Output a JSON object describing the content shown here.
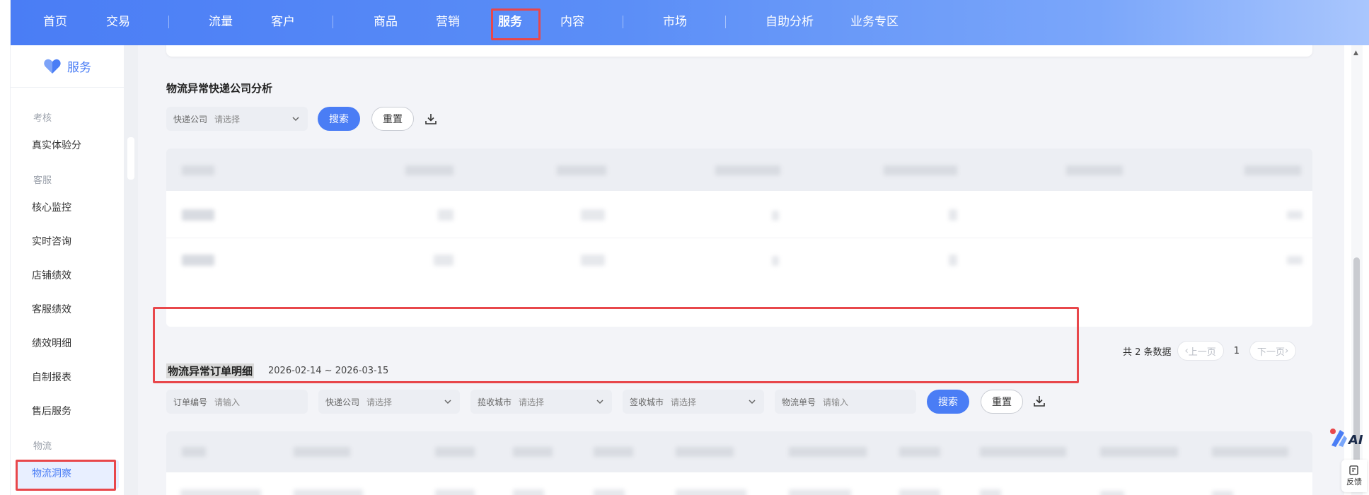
{
  "topnav": {
    "items": [
      "首页",
      "交易",
      "流量",
      "客户",
      "商品",
      "营销",
      "服务",
      "内容",
      "市场",
      "自助分析",
      "业务专区"
    ],
    "active_index": 6
  },
  "sidebar": {
    "brand": "服务",
    "groups": [
      "考核",
      "客服",
      "物流"
    ],
    "items": {
      "kaohe": [
        "真实体验分"
      ],
      "kefu": [
        "核心监控",
        "实时咨询",
        "店铺绩效",
        "客服绩效",
        "绩效明细",
        "自制报表",
        "售后服务"
      ],
      "wuliu": [
        "物流洞察"
      ]
    },
    "active_item": "物流洞察"
  },
  "express_analysis": {
    "title": "物流异常快递公司分析",
    "filter_label": "快递公司",
    "filter_placeholder": "请选择",
    "search_label": "搜索",
    "reset_label": "重置"
  },
  "pager": {
    "total": "共 2 条数据",
    "prev": "上一页",
    "page": "1",
    "next": "下一页"
  },
  "order_detail": {
    "title": "物流异常订单明细",
    "date_range": "2026-02-14 ~ 2026-03-15",
    "filters": [
      {
        "label": "订单编号",
        "placeholder": "请输入",
        "type": "input"
      },
      {
        "label": "快递公司",
        "placeholder": "请选择",
        "type": "select"
      },
      {
        "label": "揽收城市",
        "placeholder": "请选择",
        "type": "select"
      },
      {
        "label": "签收城市",
        "placeholder": "请选择",
        "type": "select"
      },
      {
        "label": "物流单号",
        "placeholder": "请输入",
        "type": "input"
      }
    ],
    "search_label": "搜索",
    "reset_label": "重置"
  },
  "floating": {
    "ai_label": "AI",
    "feedback_label": "反馈"
  },
  "colors": {
    "accent": "#4a7df5",
    "highlight_box": "#e8474b"
  }
}
